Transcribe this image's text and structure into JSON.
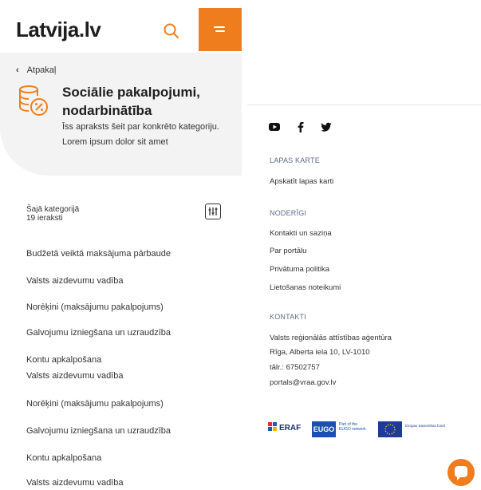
{
  "header": {
    "logo_text": "Latvija.lv",
    "search_icon": "search-icon",
    "menu_icon": "menu-icon",
    "accent_color": "#f07d1d"
  },
  "category": {
    "back_label": "Atpakaļ",
    "title": "Sociālie pakalpojumi, nodarbinātība",
    "description": "Īss apraksts šeit par konkrēto kategoriju. Lorem ipsum dolor sit amet",
    "icon": "coins-percent-icon"
  },
  "listing": {
    "count_label": "Šajā kategorijā",
    "count_value": "19 ieraksti",
    "filter_icon": "filter-icon",
    "items": [
      "Budžetā veiktā maksājuma pārbaude",
      "Valsts aizdevumu vadība",
      "Norēķini (maksājumu pakalpojums)",
      "Galvojumu izniegšana un uzraudzība",
      "Kontu apkalpošana",
      "Valsts aizdevumu vadība",
      "Norēķini (maksājumu pakalpojums)",
      "Galvojumu izniegšana un uzraudzība",
      "Kontu apkalpošana",
      "Valsts aizdevumu vadība"
    ]
  },
  "footer": {
    "social": [
      "youtube-icon",
      "facebook-icon",
      "twitter-icon"
    ],
    "sitemap": {
      "heading": "LAPAS KARTE",
      "link": "Apskatīt lapas karti"
    },
    "useful": {
      "heading": "NODERĪGI",
      "links": [
        "Kontakti un saziņa",
        "Par portālu",
        "Privātuma politika",
        "Lietošanas noteikumi"
      ]
    },
    "contacts": {
      "heading": "KONTAKTI",
      "lines": [
        "Valsts reģionālās attīstības aģentūra",
        "Rīga, Alberta iela 10, LV-1010",
        "tālr.: 67502757",
        "portals@vraa.gov.lv"
      ]
    },
    "logos": {
      "eraf": "ERAF",
      "eugo": "EUGO",
      "eugo_sub": "Part of the EUGO network",
      "eu": "Eiropas Savienības fondi"
    },
    "chat_icon": "chat-icon"
  }
}
